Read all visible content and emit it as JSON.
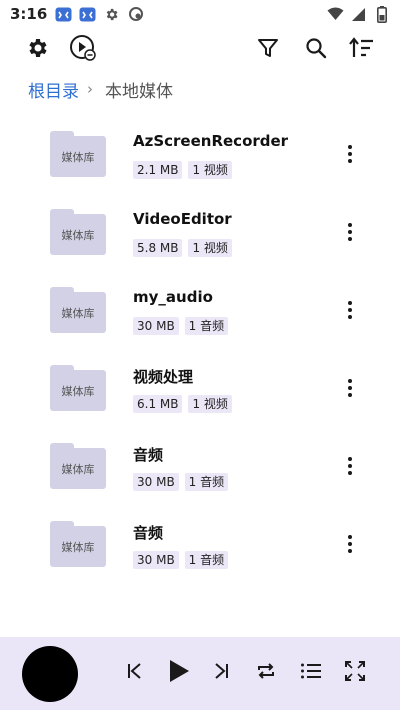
{
  "status_bar": {
    "time": "3:16",
    "left_icons": [
      "gamepad-icon",
      "gamepad-icon",
      "gear-icon",
      "clean-icon"
    ],
    "right_icons": [
      "wifi-icon",
      "signal-icon",
      "battery-icon"
    ]
  },
  "toolbar": {
    "left_icons": [
      "settings-icon",
      "play-circle-link-icon"
    ],
    "right_icons": [
      "filter-icon",
      "search-icon",
      "sort-icon"
    ]
  },
  "breadcrumb": {
    "root": "根目录",
    "separator": "›",
    "current": "本地媒体"
  },
  "folders": [
    {
      "icon_label": "媒体库",
      "name": "AzScreenRecorder",
      "size": "2.1 MB",
      "count": "1 视频"
    },
    {
      "icon_label": "媒体库",
      "name": "VideoEditor",
      "size": "5.8 MB",
      "count": "1 视频"
    },
    {
      "icon_label": "媒体库",
      "name": "my_audio",
      "size": "30 MB",
      "count": "1 音频"
    },
    {
      "icon_label": "媒体库",
      "name": "视频处理",
      "size": "6.1 MB",
      "count": "1 视频"
    },
    {
      "icon_label": "媒体库",
      "name": "音频",
      "size": "30 MB",
      "count": "1 音频"
    },
    {
      "icon_label": "媒体库",
      "name": "音频",
      "size": "30 MB",
      "count": "1 音频"
    }
  ],
  "player": {
    "controls": [
      "skip-previous-icon",
      "play-icon",
      "skip-next-icon",
      "repeat-icon",
      "playlist-icon",
      "fullscreen-icon"
    ]
  },
  "colors": {
    "accent": "#2f6fd1",
    "folder": "#d3d1e6",
    "tag_bg": "#ebe7f7",
    "player_bg": "#eae6f7"
  }
}
